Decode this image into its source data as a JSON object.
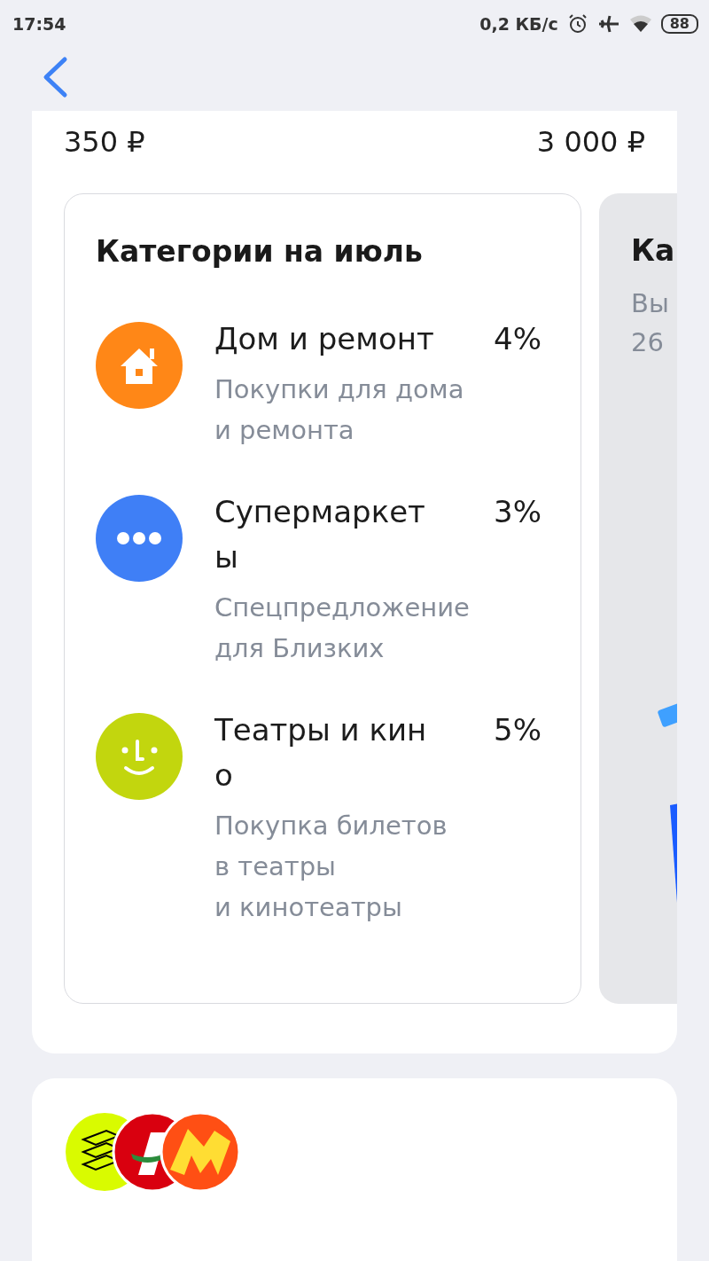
{
  "status_bar": {
    "time": "17:54",
    "speed": "0,2 КБ/с",
    "battery": "88"
  },
  "earnings": {
    "earned": "350 ₽",
    "limit": "3 000 ₽"
  },
  "category_card": {
    "title": "Категории на июль",
    "items": [
      {
        "kind": "house",
        "color": "#ff8717",
        "name": "Дом и ремонт",
        "percent": "4%",
        "description": "Покупки для дома\nи ремонта"
      },
      {
        "kind": "dots",
        "color": "#3f7ff6",
        "name": "Супермаркеты",
        "percent": "3%",
        "description": "Спецпредложение\nдля Близких"
      },
      {
        "kind": "face",
        "color": "#c2d60e",
        "name": "Театры и кино",
        "percent": "5%",
        "description": "Покупка билетов\nв театры\nи кинотеатры"
      }
    ]
  },
  "next_card": {
    "title": "Ка",
    "line_1": "Вы",
    "line_2": "26"
  },
  "partner_logos": [
    {
      "kind": "stack"
    },
    {
      "kind": "slash"
    },
    {
      "kind": "zigzag"
    }
  ]
}
